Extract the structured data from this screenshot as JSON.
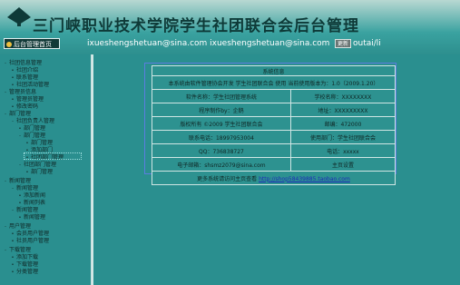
{
  "header": {
    "title": "三门峡职业技术学院学生社团联合会后台管理",
    "home_button": "后台管理首页",
    "marquee_text": "ixueshengshetuan@sina.com  ixueshengshetuan@sina.com",
    "go_button": "更新",
    "url_tail": "outai/li"
  },
  "sidebar": {
    "items": [
      {
        "marker": "-",
        "label": "社团信息管理"
      },
      {
        "marker": "•",
        "label": "社团介绍"
      },
      {
        "marker": "•",
        "label": "联系管理"
      },
      {
        "marker": "•",
        "label": "社团活动管理"
      },
      {
        "marker": "-",
        "label": "管理员信息"
      },
      {
        "marker": "•",
        "label": "管理员管理"
      },
      {
        "marker": "•",
        "label": "修改密码"
      },
      {
        "marker": "-",
        "label": "部门管理"
      },
      {
        "marker": "-",
        "label": "社团负责人管理"
      },
      {
        "marker": "•",
        "label": "部门管理"
      },
      {
        "marker": "-",
        "label": "部门管理"
      },
      {
        "marker": "•",
        "label": "部门管理"
      },
      {
        "marker": "•",
        "label": "添加部门"
      },
      {
        "marker": "•",
        "label": "社团部门管理"
      },
      {
        "marker": "-",
        "label": "社团部门管理"
      },
      {
        "marker": "•",
        "label": "部门管理"
      },
      {
        "marker": "-",
        "label": "新闻管理"
      },
      {
        "marker": "-",
        "label": "新闻管理"
      },
      {
        "marker": "•",
        "label": "添加新闻"
      },
      {
        "marker": "•",
        "label": "新闻列表"
      },
      {
        "marker": "-",
        "label": "新闻管理"
      },
      {
        "marker": "•",
        "label": "新闻管理"
      },
      {
        "marker": "-",
        "label": "用户管理"
      },
      {
        "marker": "•",
        "label": "会员用户管理"
      },
      {
        "marker": "•",
        "label": "社员用户管理"
      },
      {
        "marker": "-",
        "label": "下载管理"
      },
      {
        "marker": "•",
        "label": "添加下载"
      },
      {
        "marker": "•",
        "label": "下载管理"
      },
      {
        "marker": "•",
        "label": "分类管理"
      }
    ]
  },
  "info": {
    "header": "系统信息",
    "notice": "本系统由软件管理协会开发  学生社团联合会  使用  当前使用版本为：1.0（2009.1.20）",
    "rows": [
      {
        "label": "软件名称：学生社团管理系统",
        "value": "学校名称：XXXXXXXX"
      },
      {
        "label": "程序制作by：企鹅",
        "value": "地址：XXXXXXXXX"
      },
      {
        "label": "版权所有 ©2009 学生社团联合会",
        "value": "邮编：472000"
      },
      {
        "label": "联系电话：18997953004",
        "value": "使用部门：学生社团联合会"
      },
      {
        "label": "QQ：736838727",
        "value": "电话：xxxxx"
      },
      {
        "label": "电子邮箱：shsmz2079@sina.com",
        "value": "主页设置"
      }
    ],
    "footer_text": "更多系统请访问主页查看",
    "footer_link": "http://shop58439885.taobao.com"
  },
  "colors": {
    "background": "#2a8f8f",
    "header_light": "#b8d8d2",
    "border": "#cfe6e4",
    "selection_frame": "#5b7de0",
    "link": "#1e2ab8"
  }
}
